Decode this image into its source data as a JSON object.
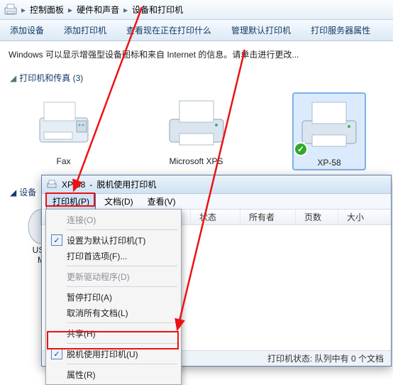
{
  "breadcrumb": {
    "root": "控制面板",
    "mid": "硬件和声音",
    "leaf": "设备和打印机"
  },
  "toolbar": {
    "add_device": "添加设备",
    "add_printer": "添加打印机",
    "see_printing": "查看现在正在打印什么",
    "manage_default": "管理默认打印机",
    "server_props": "打印服务器属性"
  },
  "info_line": "Windows 可以显示增强型设备图标和来自 Internet 的信息。请单击进行更改...",
  "section_printers": "打印机和传真 (3)",
  "devices": {
    "fax": "Fax",
    "msxps": "Microsoft XPS",
    "xp58": "XP-58"
  },
  "section_devices": "设备",
  "usb_label_1": "USB",
  "usb_label_2": "M",
  "child": {
    "title_app": "XP-58",
    "title_state": "脱机使用打印机",
    "menu": {
      "printer": "打印机(P)",
      "doc": "文档(D)",
      "view": "查看(V)"
    },
    "cols": {
      "name": "",
      "status": "状态",
      "owner": "所有者",
      "pages": "页数",
      "size": "大小"
    },
    "status_line": "打印机状态: 队列中有 0 个文档"
  },
  "dropdown": {
    "connect": "连接(O)",
    "set_default": "设置为默认打印机(T)",
    "prefs": "打印首选项(F)...",
    "update_driver": "更新驱动程序(D)",
    "pause": "暂停打印(A)",
    "cancel_all": "取消所有文档(L)",
    "share": "共享(H)",
    "offline": "脱机使用打印机(U)",
    "properties": "属性(R)"
  }
}
